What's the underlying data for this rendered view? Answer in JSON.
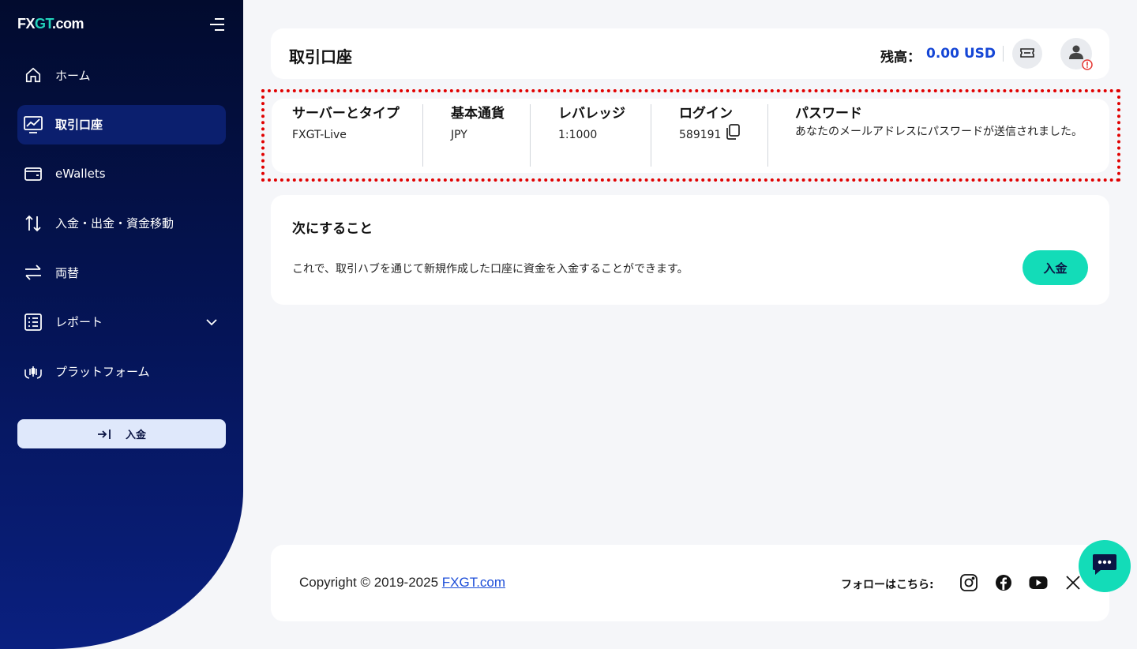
{
  "sidebar": {
    "logo": {
      "part1": "FX",
      "part2": "GT",
      "part3": ".com"
    },
    "items": [
      {
        "label": "ホーム",
        "icon": "home-icon"
      },
      {
        "label": "取引口座",
        "icon": "chart-icon",
        "active": true
      },
      {
        "label": "eWallets",
        "icon": "wallet-icon"
      },
      {
        "label": "入金・出金・資金移動",
        "icon": "transfer-icon"
      },
      {
        "label": "両替",
        "icon": "exchange-icon"
      },
      {
        "label": "レポート",
        "icon": "report-icon"
      },
      {
        "label": "プラットフォーム",
        "icon": "platform-icon"
      }
    ],
    "deposit_button": "入金"
  },
  "header": {
    "title": "取引口座",
    "balance_label": "残高：",
    "balance_value": "0.00 USD"
  },
  "account": {
    "server_label": "サーバーとタイプ",
    "server_value": "FXGT-Live",
    "currency_label": "基本通貨",
    "currency_value": "JPY",
    "leverage_label": "レバレッジ",
    "leverage_value": "1:1000",
    "login_label": "ログイン",
    "login_value": "589191",
    "password_label": "パスワード",
    "password_value": "あなたのメールアドレスにパスワードが送信されました。"
  },
  "next": {
    "title": "次にすること",
    "text": "これで、取引ハブを通じて新規作成した口座に資金を入金することができます。",
    "button": "入金"
  },
  "footer": {
    "copyright": "Copyright © 2019-2025 ",
    "link": "FXGT.com",
    "follow": "フォローはこちら:"
  },
  "colors": {
    "accent": "#13dcb8",
    "balance": "#1546d6",
    "sidebar": "#05155a",
    "highlight": "#e10000"
  }
}
